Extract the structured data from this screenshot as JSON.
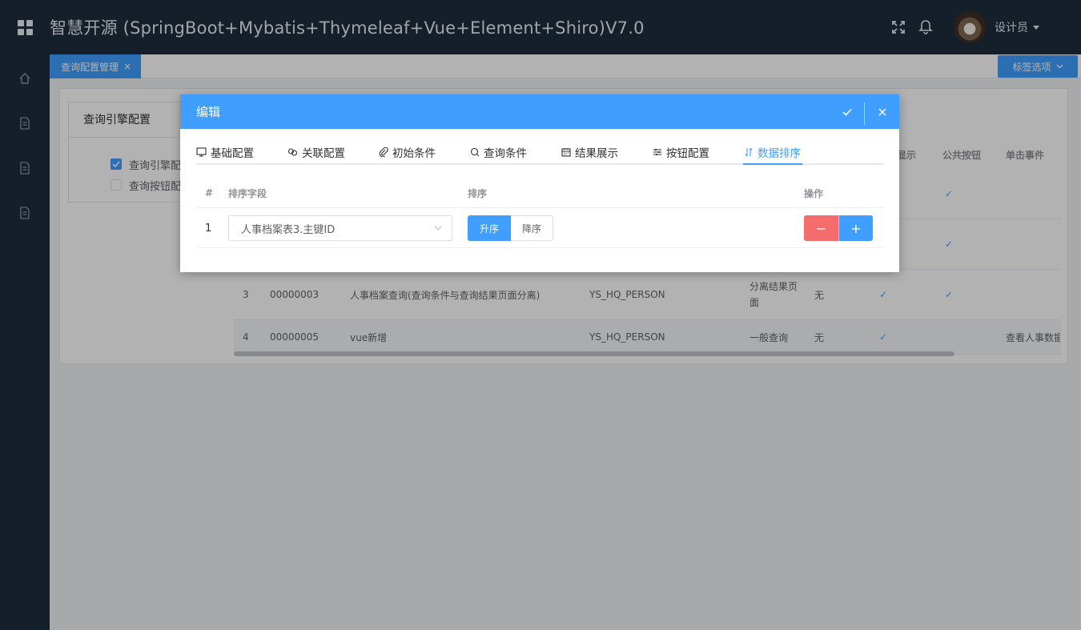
{
  "header": {
    "title": "智慧开源 (SpringBoot+Mybatis+Thymeleaf+Vue+Element+Shiro)V7.0",
    "user_name": "设计员",
    "icons": [
      "menu-grid-icon",
      "fullscreen-icon",
      "bell-icon",
      "avatar"
    ]
  },
  "sidebar": {
    "items": [
      "home-icon",
      "document-icon",
      "document-icon",
      "document-icon"
    ]
  },
  "tabsbar": {
    "active_tab": "查询配置管理",
    "close_glyph": "×",
    "options_label": "标签选项"
  },
  "background": {
    "card_title": "查询引擎配置",
    "checkbox_1": "查询引擎配",
    "checkbox_2": "查询按钮配",
    "columns_partial": [
      "显示",
      "公共按钮",
      "单击事件"
    ],
    "rows": [
      {
        "index": "3",
        "code": "00000003",
        "name": "人事档案查询(查询条件与查询结果页面分离)",
        "table": "YS_HQ_PERSON",
        "type_line1": "分离结果页",
        "type_line2": "面",
        "remark": "无",
        "event": ""
      },
      {
        "index": "4",
        "code": "00000005",
        "name": "vue新增",
        "table": "YS_HQ_PERSON",
        "type_line1": "一般查询",
        "type_line2": "",
        "remark": "无",
        "event": "查看人事数据"
      }
    ],
    "check_glyph": "✓"
  },
  "modal": {
    "title": "编辑",
    "tabs": [
      {
        "label": "基础配置",
        "icon": "monitor-icon"
      },
      {
        "label": "关联配置",
        "icon": "link-icon"
      },
      {
        "label": "初始条件",
        "icon": "paperclip-icon"
      },
      {
        "label": "查询条件",
        "icon": "search-icon"
      },
      {
        "label": "结果展示",
        "icon": "calendar-icon"
      },
      {
        "label": "按钮配置",
        "icon": "sliders-icon"
      },
      {
        "label": "数据排序",
        "icon": "sort-icon"
      }
    ],
    "active_tab": "数据排序",
    "table": {
      "headers": {
        "index": "#",
        "field": "排序字段",
        "order": "排序",
        "ops": "操作"
      },
      "rows": [
        {
          "index": "1",
          "field_value": "人事档案表3.主键ID",
          "order_asc": "升序",
          "order_desc": "降序",
          "selected_order": "升序",
          "minus": "−",
          "plus": "+"
        }
      ]
    }
  },
  "colors": {
    "header_bg": "#1f2d3d",
    "accent": "#409eff",
    "danger": "#f56c6c"
  }
}
